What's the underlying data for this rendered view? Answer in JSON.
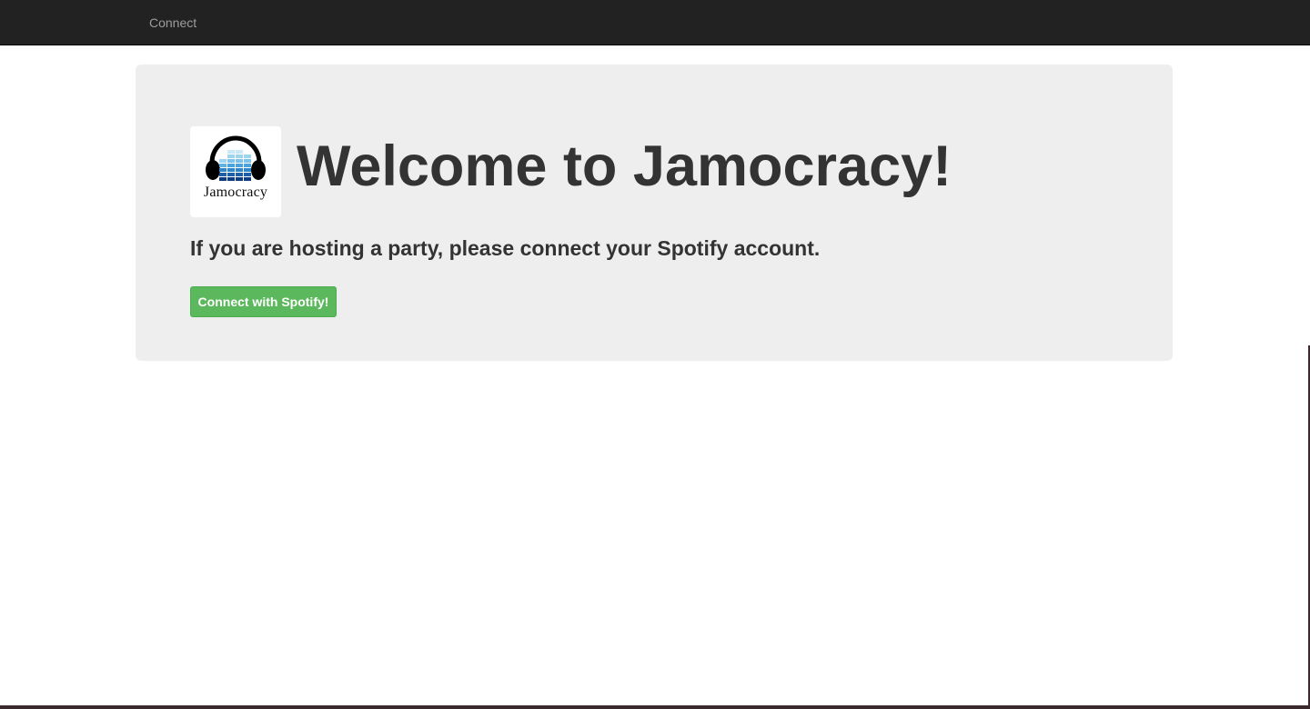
{
  "navbar": {
    "link_label": "Connect"
  },
  "jumbotron": {
    "logo_text": "Jamocracy",
    "headline": "Welcome to Jamocracy!",
    "lead": "If you are hosting a party, please connect your Spotify account.",
    "button_label": "Connect with Spotify!"
  },
  "colors": {
    "navbar_bg": "#222222",
    "jumbotron_bg": "#eeeeee",
    "button_bg": "#5cb85c",
    "text": "#333333"
  }
}
